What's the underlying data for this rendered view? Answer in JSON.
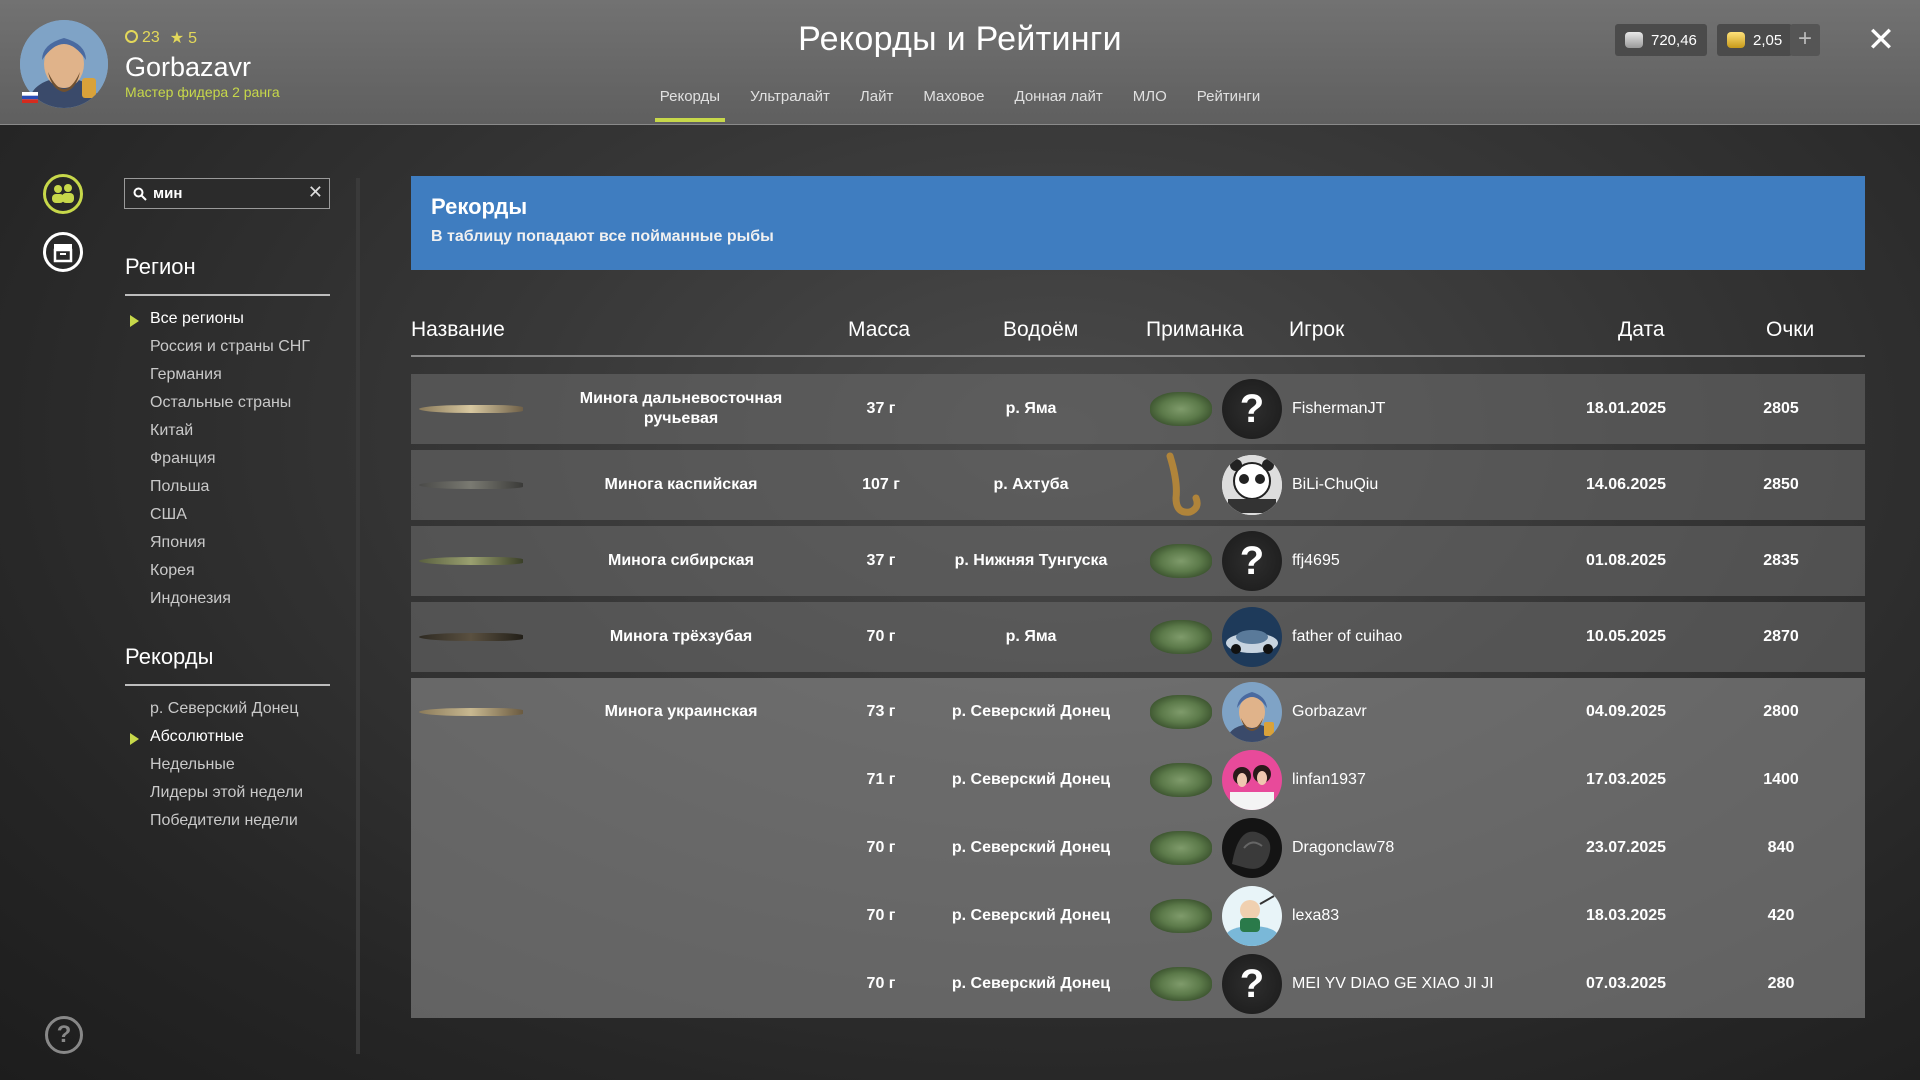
{
  "header": {
    "level": "23",
    "stars": "5",
    "username": "Gorbazavr",
    "rank": "Мастер фидера 2 ранга",
    "title": "Рекорды и Рейтинги",
    "silver": "720,46",
    "gold": "2,05",
    "tabs": [
      "Рекорды",
      "Ультралайт",
      "Лайт",
      "Маховое",
      "Донная лайт",
      "МЛО",
      "Рейтинги"
    ],
    "active_tab": "Рекорды"
  },
  "search": {
    "value": "мин"
  },
  "region_section": {
    "title": "Регион",
    "items": [
      "Все регионы",
      "Россия и страны СНГ",
      "Германия",
      "Остальные страны",
      "Китай",
      "Франция",
      "Польша",
      "США",
      "Япония",
      "Корея",
      "Индонезия"
    ],
    "active": "Все регионы"
  },
  "records_section": {
    "title": "Рекорды",
    "items": [
      "р. Северский Донец",
      "Абсолютные",
      "Недельные",
      "Лидеры этой недели",
      "Победители недели"
    ],
    "active": "Абсолютные"
  },
  "banner": {
    "title": "Рекорды",
    "subtitle": "В таблицу попадают все пойманные рыбы"
  },
  "table": {
    "headers": {
      "name": "Название",
      "mass": "Масса",
      "water": "Водоём",
      "bait": "Приманка",
      "player": "Игрок",
      "date": "Дата",
      "score": "Очки"
    },
    "rows": [
      {
        "fish": "Минога дальневосточная ручьевая",
        "mass": "37 г",
        "water": "р. Яма",
        "bait": "grass-bait",
        "avatar": "question",
        "player": "FishermanJT",
        "date": "18.01.2025",
        "score": "2805"
      },
      {
        "fish": "Минога каспийская",
        "mass": "107 г",
        "water": "р. Ахтуба",
        "bait": "worm-lure",
        "avatar": "panda",
        "player": "BiLi-ChuQiu",
        "date": "14.06.2025",
        "score": "2850"
      },
      {
        "fish": "Минога сибирская",
        "mass": "37 г",
        "water": "р. Нижняя Тунгуска",
        "bait": "grass-bait",
        "avatar": "question",
        "player": "ffj4695",
        "date": "01.08.2025",
        "score": "2835"
      },
      {
        "fish": "Минога трёхзубая",
        "mass": "70 г",
        "water": "р. Яма",
        "bait": "grass-bait",
        "avatar": "car",
        "player": "father of cuihao",
        "date": "10.05.2025",
        "score": "2870"
      }
    ],
    "group": {
      "fish": "Минога украинская",
      "entries": [
        {
          "mass": "73 г",
          "water": "р. Северский Донец",
          "bait": "grass-bait",
          "avatar": "self",
          "player": "Gorbazavr",
          "date": "04.09.2025",
          "score": "2800"
        },
        {
          "mass": "71 г",
          "water": "р. Северский Донец",
          "bait": "grass-bait",
          "avatar": "pink",
          "player": "linfan1937",
          "date": "17.03.2025",
          "score": "1400"
        },
        {
          "mass": "70 г",
          "water": "р. Северский Донец",
          "bait": "grass-bait",
          "avatar": "dark",
          "player": "Dragonclaw78",
          "date": "23.07.2025",
          "score": "840"
        },
        {
          "mass": "70 г",
          "water": "р. Северский Донец",
          "bait": "grass-bait",
          "avatar": "cartoon",
          "player": "lexa83",
          "date": "18.03.2025",
          "score": "420"
        },
        {
          "mass": "70 г",
          "water": "р. Северский Донец",
          "bait": "grass-bait",
          "avatar": "question",
          "player": "MEI YV DIAO GE XIAO JI JI",
          "date": "07.03.2025",
          "score": "280"
        }
      ]
    }
  },
  "colors": {
    "accent": "#c7d84a",
    "banner": "#3f7dc0"
  }
}
